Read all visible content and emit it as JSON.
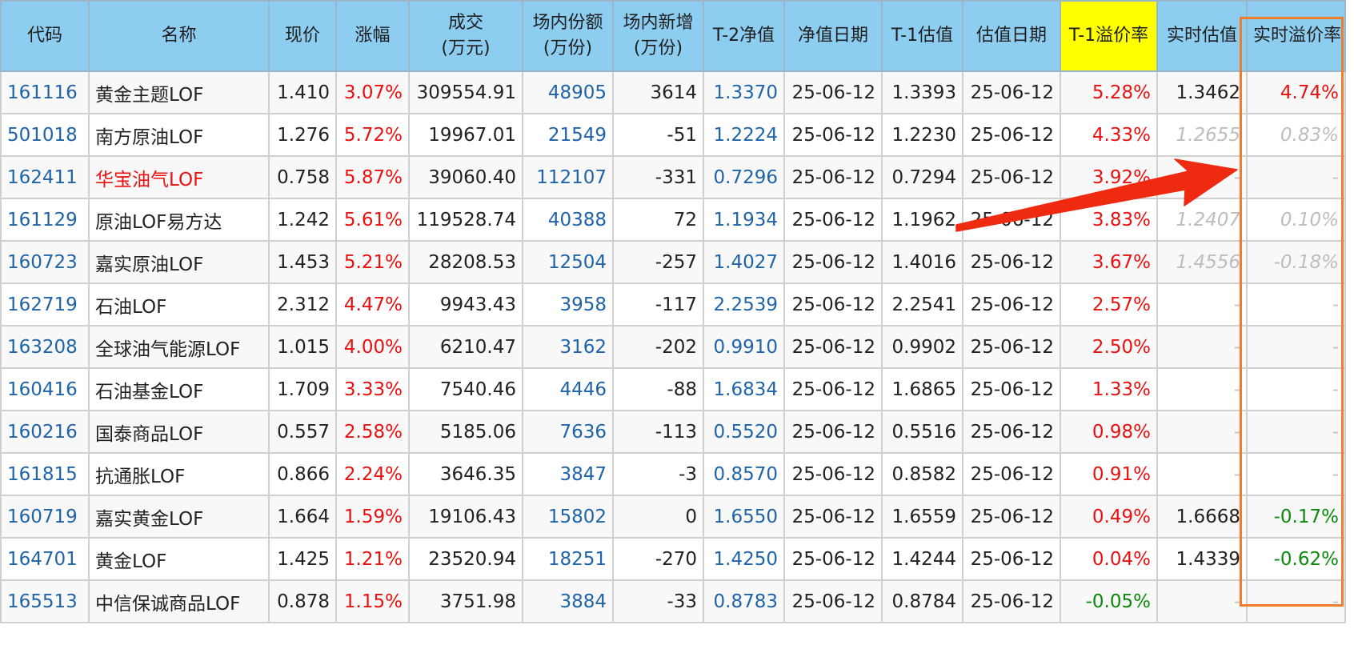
{
  "columns": [
    {
      "line1": "代码",
      "line2": ""
    },
    {
      "line1": "名称",
      "line2": ""
    },
    {
      "line1": "现价",
      "line2": ""
    },
    {
      "line1": "涨幅",
      "line2": ""
    },
    {
      "line1": "成交",
      "line2": "(万元)"
    },
    {
      "line1": "场内份额",
      "line2": "(万份)"
    },
    {
      "line1": "场内新增",
      "line2": "(万份)"
    },
    {
      "line1": "T-2净值",
      "line2": ""
    },
    {
      "line1": "净值日期",
      "line2": ""
    },
    {
      "line1": "T-1估值",
      "line2": ""
    },
    {
      "line1": "估值日期",
      "line2": ""
    },
    {
      "line1": "T-1溢价率",
      "line2": ""
    },
    {
      "line1": "实时估值",
      "line2": ""
    },
    {
      "line1": "实时溢价率",
      "line2": ""
    }
  ],
  "rows": [
    {
      "code": "161116",
      "name": "黄金主题LOF",
      "price": "1.410",
      "change": "3.07%",
      "turnover": "309554.91",
      "shares": "48905",
      "new_shares": "3614",
      "nav_t2": "1.3370",
      "nav_date": "25-06-12",
      "est_t1": "1.3393",
      "est_date": "25-06-12",
      "prem_t1": "5.28%",
      "rt_est": "1.3462",
      "rt_prem": "4.74%"
    },
    {
      "code": "501018",
      "name": "南方原油LOF",
      "price": "1.276",
      "change": "5.72%",
      "turnover": "19967.01",
      "shares": "21549",
      "new_shares": "-51",
      "nav_t2": "1.2224",
      "nav_date": "25-06-12",
      "est_t1": "1.2230",
      "est_date": "25-06-12",
      "prem_t1": "4.33%",
      "rt_est": "1.2655",
      "rt_prem": "0.83%"
    },
    {
      "code": "162411",
      "name": "华宝油气LOF",
      "price": "0.758",
      "change": "5.87%",
      "turnover": "39060.40",
      "shares": "112107",
      "new_shares": "-331",
      "nav_t2": "0.7296",
      "nav_date": "25-06-12",
      "est_t1": "0.7294",
      "est_date": "25-06-12",
      "prem_t1": "3.92%",
      "rt_est": "-",
      "rt_prem": "-"
    },
    {
      "code": "161129",
      "name": "原油LOF易方达",
      "price": "1.242",
      "change": "5.61%",
      "turnover": "119528.74",
      "shares": "40388",
      "new_shares": "72",
      "nav_t2": "1.1934",
      "nav_date": "25-06-12",
      "est_t1": "1.1962",
      "est_date": "25-06-12",
      "prem_t1": "3.83%",
      "rt_est": "1.2407",
      "rt_prem": "0.10%"
    },
    {
      "code": "160723",
      "name": "嘉实原油LOF",
      "price": "1.453",
      "change": "5.21%",
      "turnover": "28208.53",
      "shares": "12504",
      "new_shares": "-257",
      "nav_t2": "1.4027",
      "nav_date": "25-06-12",
      "est_t1": "1.4016",
      "est_date": "25-06-12",
      "prem_t1": "3.67%",
      "rt_est": "1.4556",
      "rt_prem": "-0.18%"
    },
    {
      "code": "162719",
      "name": "石油LOF",
      "price": "2.312",
      "change": "4.47%",
      "turnover": "9943.43",
      "shares": "3958",
      "new_shares": "-117",
      "nav_t2": "2.2539",
      "nav_date": "25-06-12",
      "est_t1": "2.2541",
      "est_date": "25-06-12",
      "prem_t1": "2.57%",
      "rt_est": "-",
      "rt_prem": "-"
    },
    {
      "code": "163208",
      "name": "全球油气能源LOF",
      "price": "1.015",
      "change": "4.00%",
      "turnover": "6210.47",
      "shares": "3162",
      "new_shares": "-202",
      "nav_t2": "0.9910",
      "nav_date": "25-06-12",
      "est_t1": "0.9902",
      "est_date": "25-06-12",
      "prem_t1": "2.50%",
      "rt_est": "-",
      "rt_prem": "-"
    },
    {
      "code": "160416",
      "name": "石油基金LOF",
      "price": "1.709",
      "change": "3.33%",
      "turnover": "7540.46",
      "shares": "4446",
      "new_shares": "-88",
      "nav_t2": "1.6834",
      "nav_date": "25-06-12",
      "est_t1": "1.6865",
      "est_date": "25-06-12",
      "prem_t1": "1.33%",
      "rt_est": "-",
      "rt_prem": "-"
    },
    {
      "code": "160216",
      "name": "国泰商品LOF",
      "price": "0.557",
      "change": "2.58%",
      "turnover": "5185.06",
      "shares": "7636",
      "new_shares": "-113",
      "nav_t2": "0.5520",
      "nav_date": "25-06-12",
      "est_t1": "0.5516",
      "est_date": "25-06-12",
      "prem_t1": "0.98%",
      "rt_est": "-",
      "rt_prem": "-"
    },
    {
      "code": "161815",
      "name": "抗通胀LOF",
      "price": "0.866",
      "change": "2.24%",
      "turnover": "3646.35",
      "shares": "3847",
      "new_shares": "-3",
      "nav_t2": "0.8570",
      "nav_date": "25-06-12",
      "est_t1": "0.8582",
      "est_date": "25-06-12",
      "prem_t1": "0.91%",
      "rt_est": "-",
      "rt_prem": "-"
    },
    {
      "code": "160719",
      "name": "嘉实黄金LOF",
      "price": "1.664",
      "change": "1.59%",
      "turnover": "19106.43",
      "shares": "15802",
      "new_shares": "0",
      "nav_t2": "1.6550",
      "nav_date": "25-06-12",
      "est_t1": "1.6559",
      "est_date": "25-06-12",
      "prem_t1": "0.49%",
      "rt_est": "1.6668",
      "rt_prem": "-0.17%"
    },
    {
      "code": "164701",
      "name": "黄金LOF",
      "price": "1.425",
      "change": "1.21%",
      "turnover": "23520.94",
      "shares": "18251",
      "new_shares": "-270",
      "nav_t2": "1.4250",
      "nav_date": "25-06-12",
      "est_t1": "1.4244",
      "est_date": "25-06-12",
      "prem_t1": "0.04%",
      "rt_est": "1.4339",
      "rt_prem": "-0.62%"
    },
    {
      "code": "165513",
      "name": "中信保诚商品LOF",
      "price": "0.878",
      "change": "1.15%",
      "turnover": "3751.98",
      "shares": "3884",
      "new_shares": "-33",
      "nav_t2": "0.8783",
      "nav_date": "25-06-12",
      "est_t1": "0.8784",
      "est_date": "25-06-12",
      "prem_t1": "-0.05%",
      "rt_est": "-",
      "rt_prem": "-"
    }
  ],
  "row_styles": [
    {
      "name": "",
      "rt_est": "",
      "rt_prem": "red"
    },
    {
      "name": "",
      "rt_est": "gray",
      "rt_prem": "gray"
    },
    {
      "name": "red",
      "rt_est": "dash",
      "rt_prem": "dash"
    },
    {
      "name": "",
      "rt_est": "gray",
      "rt_prem": "gray"
    },
    {
      "name": "",
      "rt_est": "gray",
      "rt_prem": "gray"
    },
    {
      "name": "",
      "rt_est": "dash",
      "rt_prem": "dash"
    },
    {
      "name": "",
      "rt_est": "dash",
      "rt_prem": "dash"
    },
    {
      "name": "",
      "rt_est": "dash",
      "rt_prem": "dash"
    },
    {
      "name": "",
      "rt_est": "dash",
      "rt_prem": "dash"
    },
    {
      "name": "",
      "rt_est": "dash",
      "rt_prem": "dash"
    },
    {
      "name": "",
      "rt_est": "",
      "rt_prem": "green"
    },
    {
      "name": "",
      "rt_est": "",
      "rt_prem": "green"
    },
    {
      "name": "",
      "rt_est": "dash",
      "rt_prem": "dash"
    }
  ],
  "colors": {
    "header_bg": "#8dcdf0",
    "highlight_header_bg": "#ffff00",
    "link_blue": "#1f64a8",
    "up_red": "#ea1010",
    "down_green": "#0a8a0a",
    "annotation_orange": "#f07d2b",
    "arrow_red": "#ee2a10"
  }
}
